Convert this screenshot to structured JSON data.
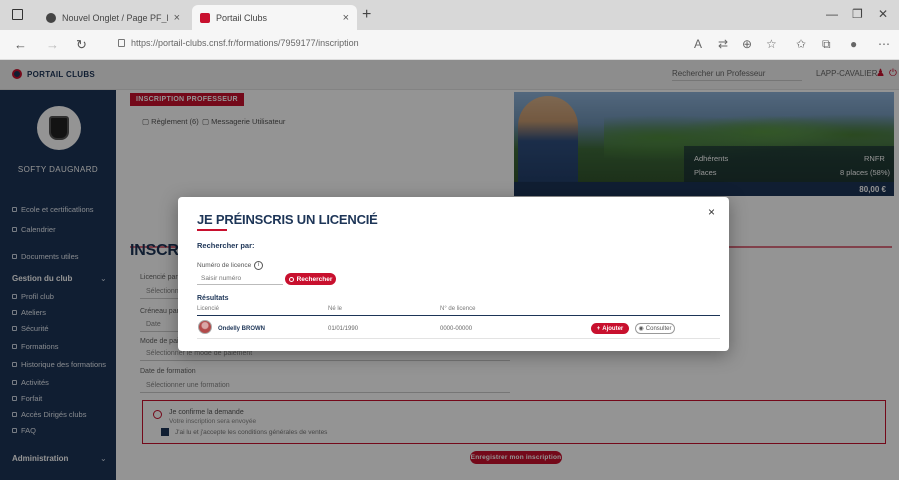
{
  "browser": {
    "tabs": [
      {
        "title": "Nouvel Onglet / Page PF_PRIVATE",
        "close": "×"
      },
      {
        "title": "Portail Clubs",
        "close": "×"
      }
    ],
    "new_tab": "+",
    "url": "https://portail-clubs.cnsf.fr/formations/7959177/inscription"
  },
  "app": {
    "logo_text": "PORTAIL CLUBS",
    "header_select": "Rechercher un Professeur",
    "header_user": "LAPP-CAVALIER"
  },
  "sidebar": {
    "club_name": "SOFTY DAUGNARD",
    "items_top": [
      "Ecole et certificatlions",
      "Calendrier",
      "Documents utiles"
    ],
    "section_club": "Gestion du club",
    "items_club": [
      "Profil club",
      "Ateliers",
      "Sécurité",
      "Formations",
      "Historique des formations",
      "Activités",
      "Forfait",
      "Accès Dirigés clubs",
      "FAQ"
    ],
    "section_admin": "Administration"
  },
  "main": {
    "red_tag": "INSCRIPTION PROFESSEUR",
    "meta_links": [
      "Règlement (6)",
      "Messagerie Utilisateur"
    ],
    "hero_rows": [
      {
        "label": "Adhérents",
        "value": "RNFR"
      },
      {
        "label": "Places",
        "value": "8 places (58%)"
      }
    ],
    "hero_price": "80,00 €",
    "inscription_title": "INSCRIPTION",
    "form_labels": [
      "Licencié participant",
      "Créneau par",
      "Mode de paiement",
      "Date de formation"
    ],
    "form_values": [
      "Sélectionnez",
      "Date",
      "Sélectionner le mode de paiement",
      "Sélectionner une formation"
    ],
    "ok_title": "Je confirme la demande",
    "ok_sub": "Votre inscription sera envoyée",
    "ok_check": "J'ai lu et j'accepte les conditions générales de ventes",
    "submit": "Enregistrer mon inscription"
  },
  "modal": {
    "title": "JE PRÉINSCRIS UN LICENCIÉ",
    "close": "×",
    "search_by": "Rechercher par:",
    "license_label": "Numéro de licence",
    "info": "i",
    "input_placeholder": "Saisir numéro",
    "search_button": "Rechercher",
    "results_label": "Résultats",
    "table_headers": [
      "Licencié",
      "Né le",
      "N° de licence"
    ],
    "row": {
      "name": "Ondelly BROWN",
      "birth": "01/01/1990",
      "license": "0000-00000"
    },
    "add_button": "Ajouter",
    "view_button": "Consulter"
  }
}
